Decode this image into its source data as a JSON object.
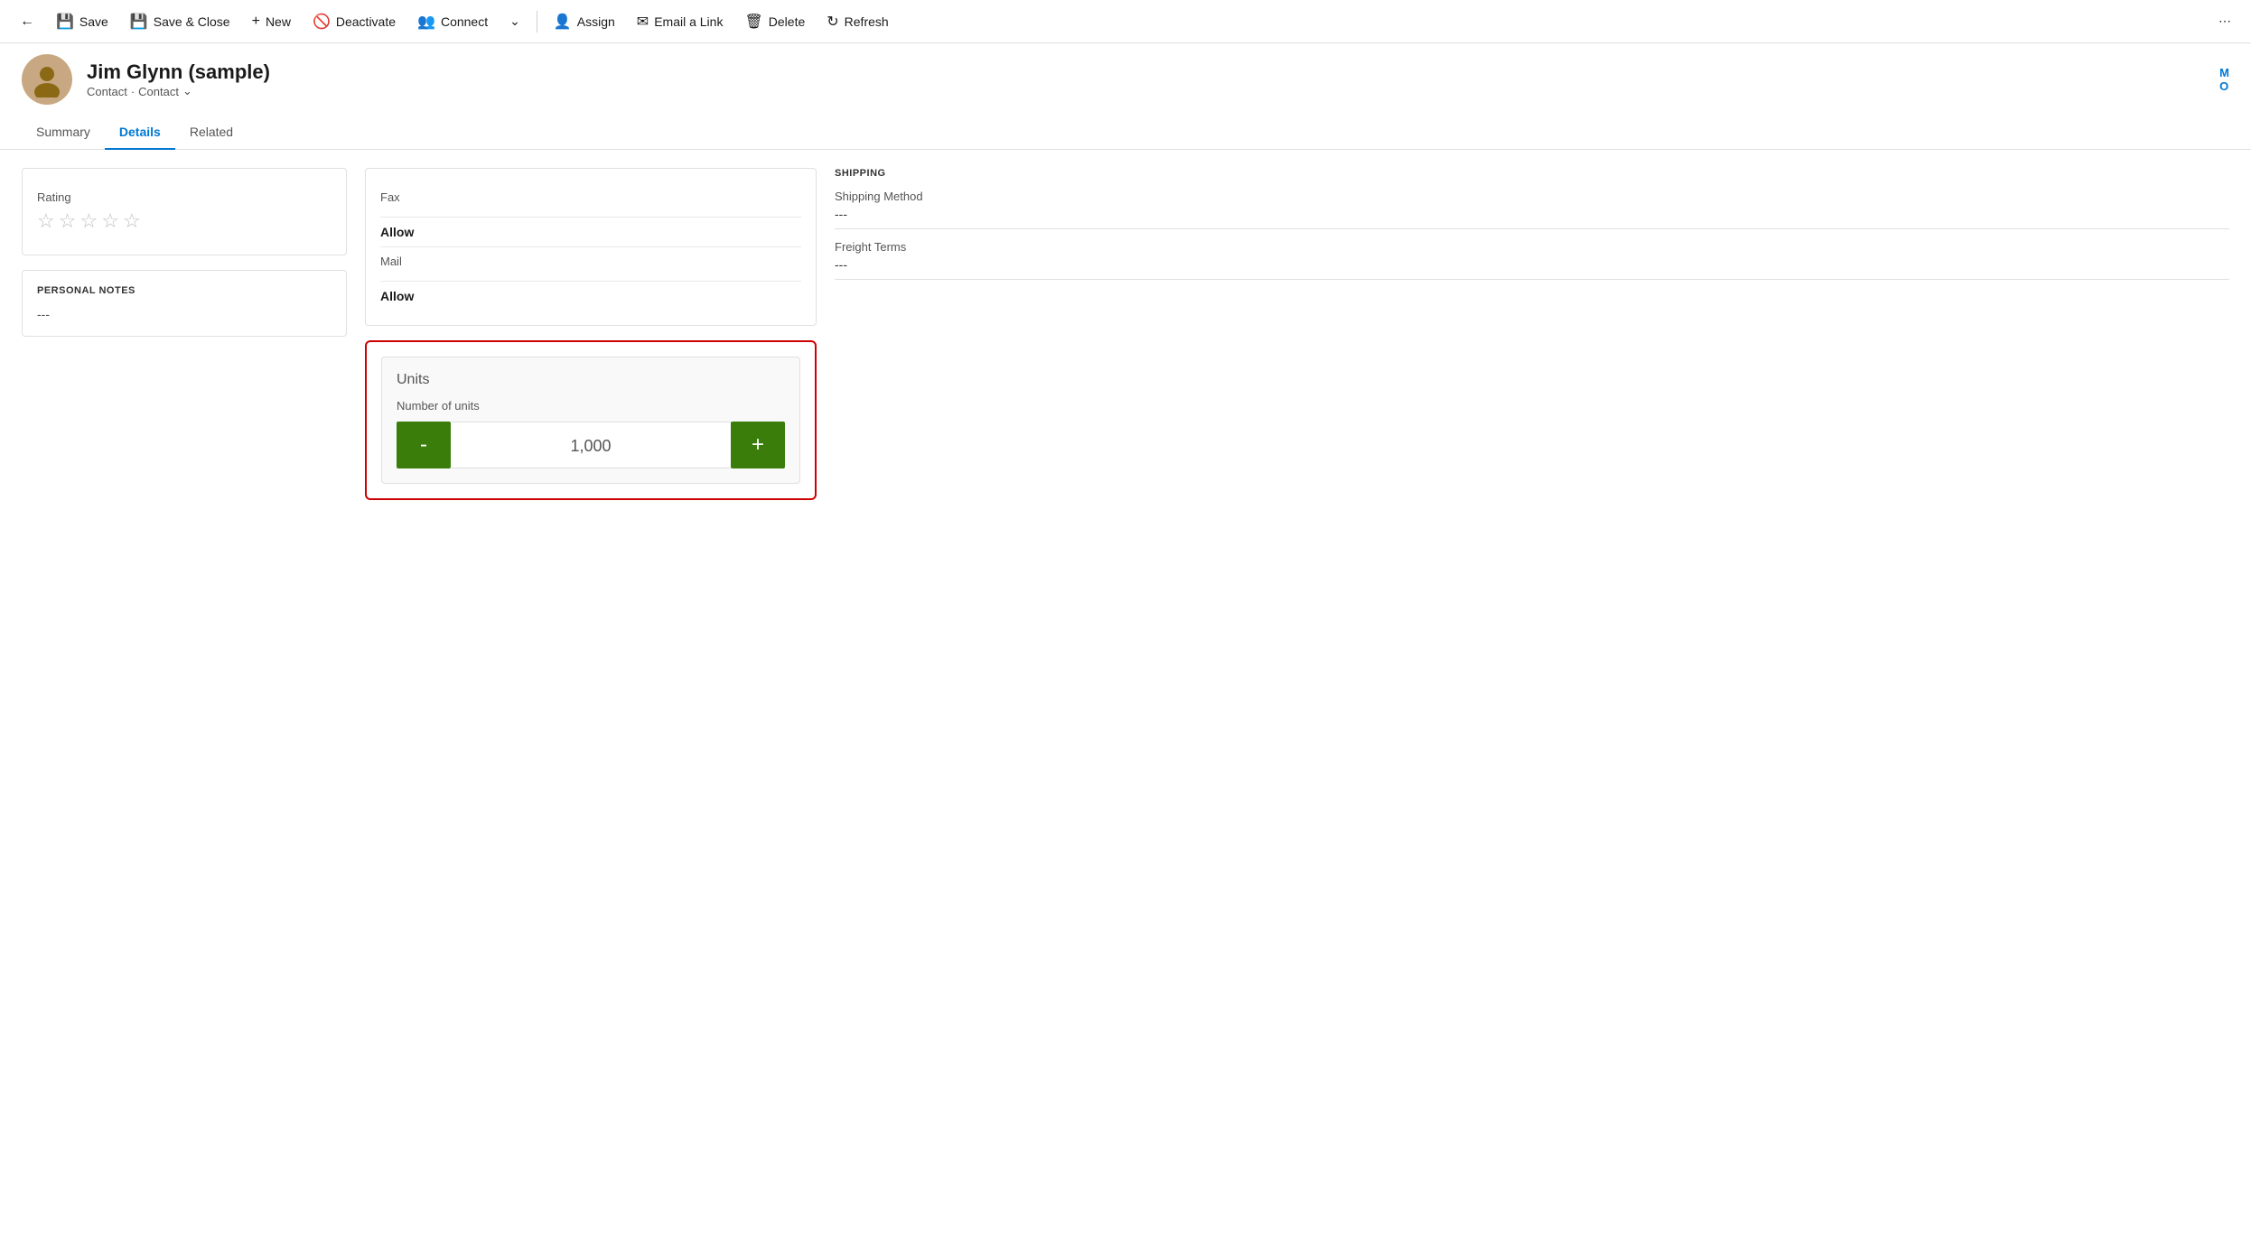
{
  "toolbar": {
    "back_icon": "←",
    "save_label": "Save",
    "save_close_label": "Save & Close",
    "new_label": "New",
    "deactivate_label": "Deactivate",
    "connect_label": "Connect",
    "dropdown_icon": "⌄",
    "assign_label": "Assign",
    "email_link_label": "Email a Link",
    "delete_label": "Delete",
    "refresh_label": "Refresh",
    "more_icon": "⋯"
  },
  "header": {
    "name": "Jim Glynn (sample)",
    "type1": "Contact",
    "separator": "·",
    "type2": "Contact",
    "dropdown_icon": "⌄",
    "right_initials": "M\nO"
  },
  "tabs": [
    {
      "id": "summary",
      "label": "Summary",
      "active": false
    },
    {
      "id": "details",
      "label": "Details",
      "active": true
    },
    {
      "id": "related",
      "label": "Related",
      "active": false
    }
  ],
  "left_column": {
    "rating_card": {
      "label": "Rating",
      "stars": [
        "☆",
        "☆",
        "☆",
        "☆",
        "☆"
      ]
    },
    "personal_notes_card": {
      "title": "PERSONAL NOTES",
      "value": "---"
    }
  },
  "middle_column": {
    "contact_section": {
      "fields": [
        {
          "label": "Fax",
          "value": ""
        },
        {
          "label": "",
          "value": "Allow",
          "bold": true
        },
        {
          "label": "Mail",
          "value": ""
        },
        {
          "label": "",
          "value": "Allow",
          "bold": true
        }
      ]
    },
    "units_section": {
      "title": "Units",
      "field_label": "Number of units",
      "value": "1,000",
      "minus_label": "-",
      "plus_label": "+"
    }
  },
  "right_column": {
    "shipping": {
      "title": "SHIPPING",
      "fields": [
        {
          "label": "Shipping Method",
          "value": "---"
        },
        {
          "label": "Freight Terms",
          "value": "---"
        }
      ]
    }
  }
}
